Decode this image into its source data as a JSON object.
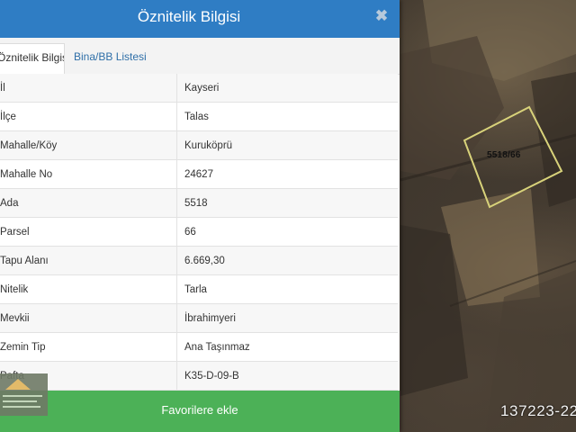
{
  "panel": {
    "title": "Öznitelik Bilgisi",
    "close_glyph": "✖",
    "tabs": [
      {
        "label": "Öznitelik Bilgisi",
        "active": true
      },
      {
        "label": "Bina/BB Listesi",
        "active": false
      }
    ],
    "rows": [
      {
        "key": "İl",
        "value": "Kayseri"
      },
      {
        "key": "İlçe",
        "value": "Talas"
      },
      {
        "key": "Mahalle/Köy",
        "value": "Kuruköprü"
      },
      {
        "key": "Mahalle No",
        "value": "24627"
      },
      {
        "key": "Ada",
        "value": "5518"
      },
      {
        "key": "Parsel",
        "value": "66"
      },
      {
        "key": "Tapu Alanı",
        "value": "6.669,30"
      },
      {
        "key": "Nitelik",
        "value": "Tarla"
      },
      {
        "key": "Mevkii",
        "value": "İbrahimyeri"
      },
      {
        "key": "Zemin Tip",
        "value": "Ana Taşınmaz"
      },
      {
        "key": "Pafta",
        "value": "K35-D-09-B"
      }
    ],
    "favorite_label": "Favorilere ekle"
  },
  "map": {
    "parcel_label": "5518/66",
    "overlay_id": "137223-22",
    "parcel_outline_color": "#d8d27a"
  },
  "colors": {
    "header": "#2f7dc4",
    "favorite_button": "#4cb157",
    "tab_link": "#2f6fa8"
  }
}
